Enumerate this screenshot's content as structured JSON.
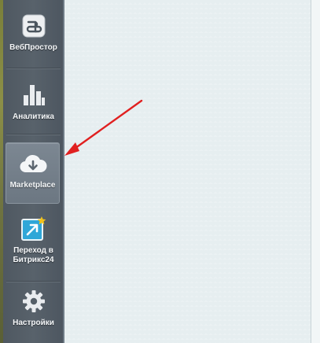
{
  "sidebar": {
    "items": [
      {
        "label": "ВебПростор",
        "icon": "webprostor-logo-icon"
      },
      {
        "label": "Аналитика",
        "icon": "bar-chart-icon"
      },
      {
        "label": "Marketplace",
        "icon": "cloud-download-icon",
        "active": true
      },
      {
        "label": "Переход в Битрикс24",
        "icon": "bitrix24-transition-icon"
      },
      {
        "label": "Настройки",
        "icon": "gear-icon"
      }
    ]
  },
  "colors": {
    "sidebar_bg": "#555f68",
    "content_bg": "#e6eef0",
    "annotation_arrow": "#e02020",
    "bitrix_accent": "#2fa7d8",
    "star": "#f2c21b"
  }
}
